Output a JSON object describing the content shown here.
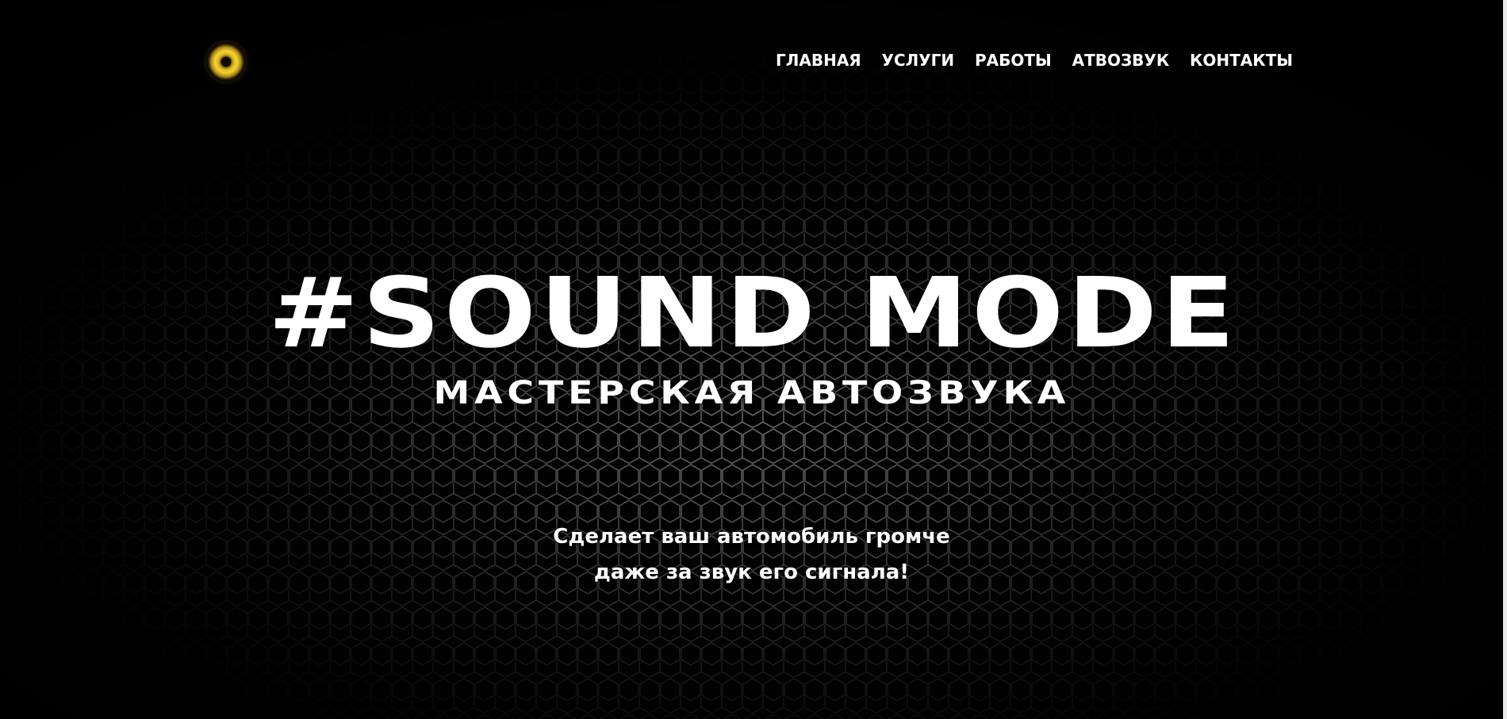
{
  "header": {
    "logo_icon": "speaker-icon",
    "nav": [
      {
        "label": "ГЛАВНАЯ"
      },
      {
        "label": "УСЛУГИ"
      },
      {
        "label": "РАБОТЫ"
      },
      {
        "label": "АТВОЗВУК"
      },
      {
        "label": "КОНТАКТЫ"
      }
    ]
  },
  "hero": {
    "title": "#SOUND MODE",
    "subtitle": "МАСТЕРСКАЯ АВТОЗВУКА",
    "tagline_line1": "Сделает ваш автомобиль громче",
    "tagline_line2": "даже за звук его сигнала!",
    "background": "speaker-grille"
  },
  "colors": {
    "background": "#000000",
    "text": "#ffffff",
    "logo_accent": "#e0ba1c",
    "grille": "#9a9a9a"
  }
}
